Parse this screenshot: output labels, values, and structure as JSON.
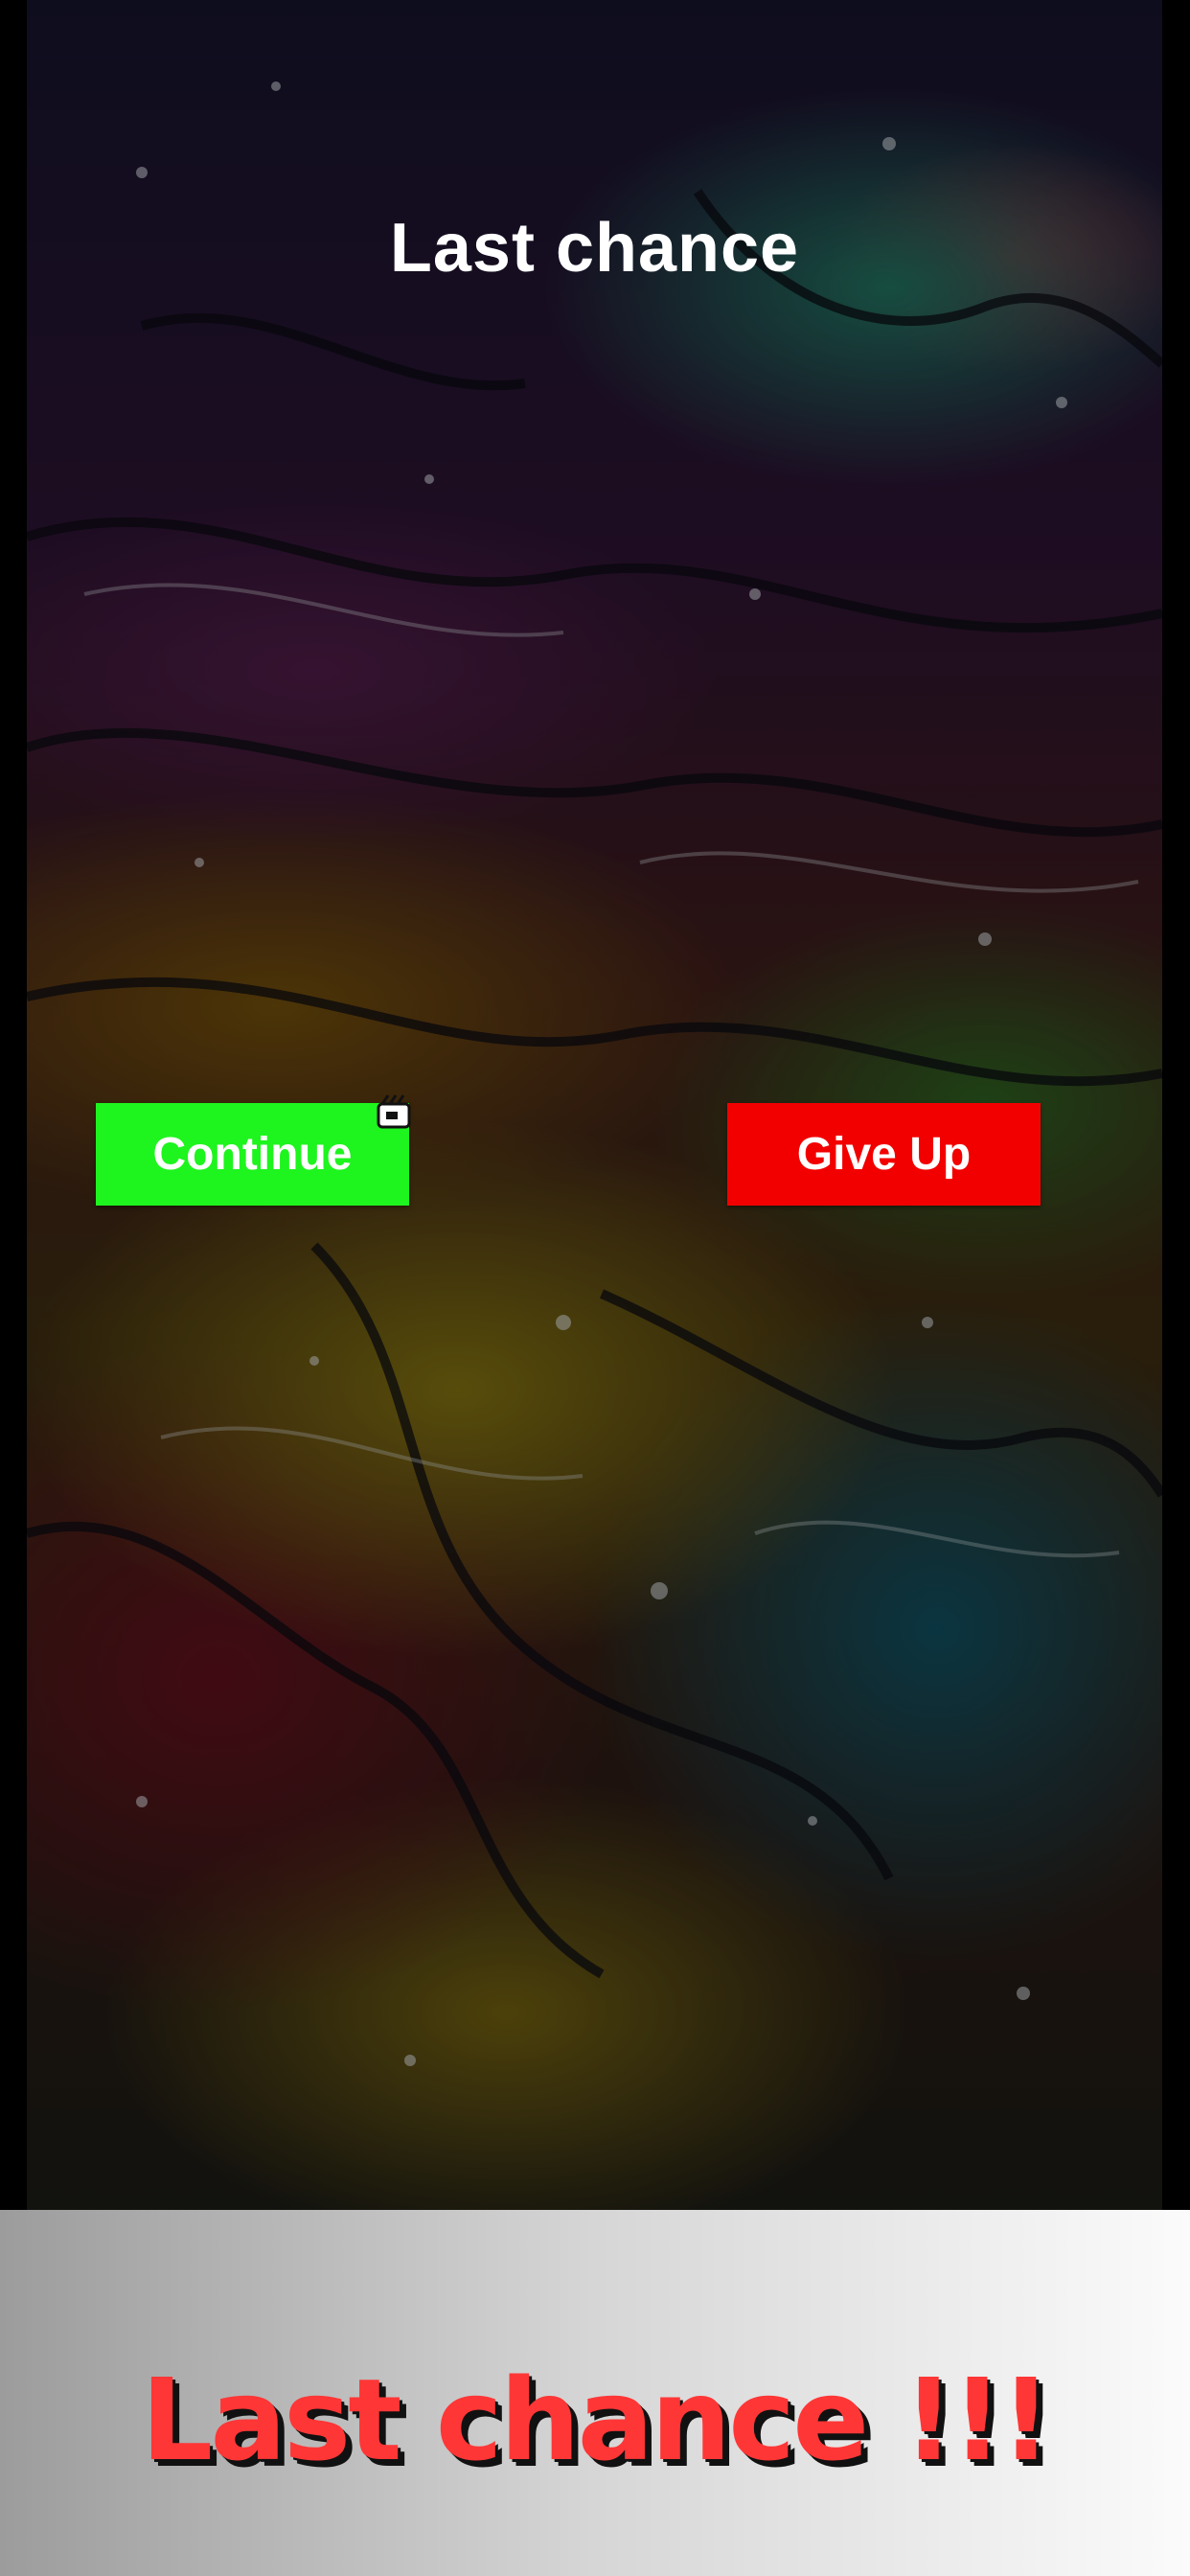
{
  "screen": {
    "title": "Last chance"
  },
  "buttons": {
    "continue_label": "Continue",
    "give_up_label": "Give Up"
  },
  "icons": {
    "ad_icon": "video-ad-icon"
  },
  "caption": {
    "text": "Last chance !!!"
  },
  "colors": {
    "continue_bg": "#1ef41e",
    "give_up_bg": "#f20000",
    "caption_text": "#ff3636"
  }
}
